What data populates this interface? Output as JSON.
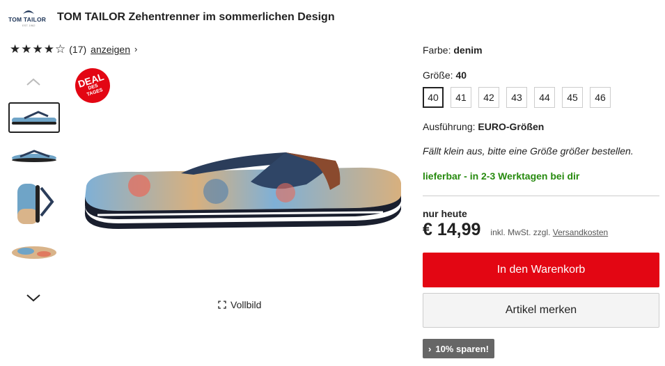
{
  "brand": {
    "name": "TOM TAILOR",
    "est": "EST. 1962"
  },
  "product": {
    "title": "TOM TAILOR Zehentrenner im sommerlichen Design"
  },
  "rating": {
    "stars": 4,
    "max": 5,
    "count": "(17)",
    "link": "anzeigen"
  },
  "badge": {
    "big": "DEAL",
    "small1": "DES",
    "small2": "TAGES"
  },
  "gallery": {
    "fullscreen_label": "Vollbild",
    "thumbnails": 4,
    "active_thumbnail": 1
  },
  "details": {
    "color_label": "Farbe:",
    "color_value": "denim",
    "size_label": "Größe:",
    "size_value": "40",
    "sizes": [
      "40",
      "41",
      "42",
      "43",
      "44",
      "45",
      "46"
    ],
    "execution_label": "Ausführung:",
    "execution_value": "EURO-Größen",
    "fit_hint": "Fällt klein aus, bitte eine Größe größer bestellen.",
    "availability": "lieferbar - in 2-3 Werktagen bei dir"
  },
  "price": {
    "caption": "nur heute",
    "value": "€ 14,99",
    "tax_note": "inkl. MwSt. zzgl.",
    "shipping_link": "Versandkosten"
  },
  "actions": {
    "add_to_cart": "In den Warenkorb",
    "remember": "Artikel merken",
    "promo": "10% sparen!"
  },
  "colors": {
    "accent_red": "#e30613",
    "availability_green": "#268a0e",
    "brand_navy": "#1e3558"
  },
  "icons": [
    "brand-logo",
    "star-icon",
    "chevron-right-icon",
    "chevron-up-icon",
    "chevron-down-icon",
    "expand-icon"
  ]
}
